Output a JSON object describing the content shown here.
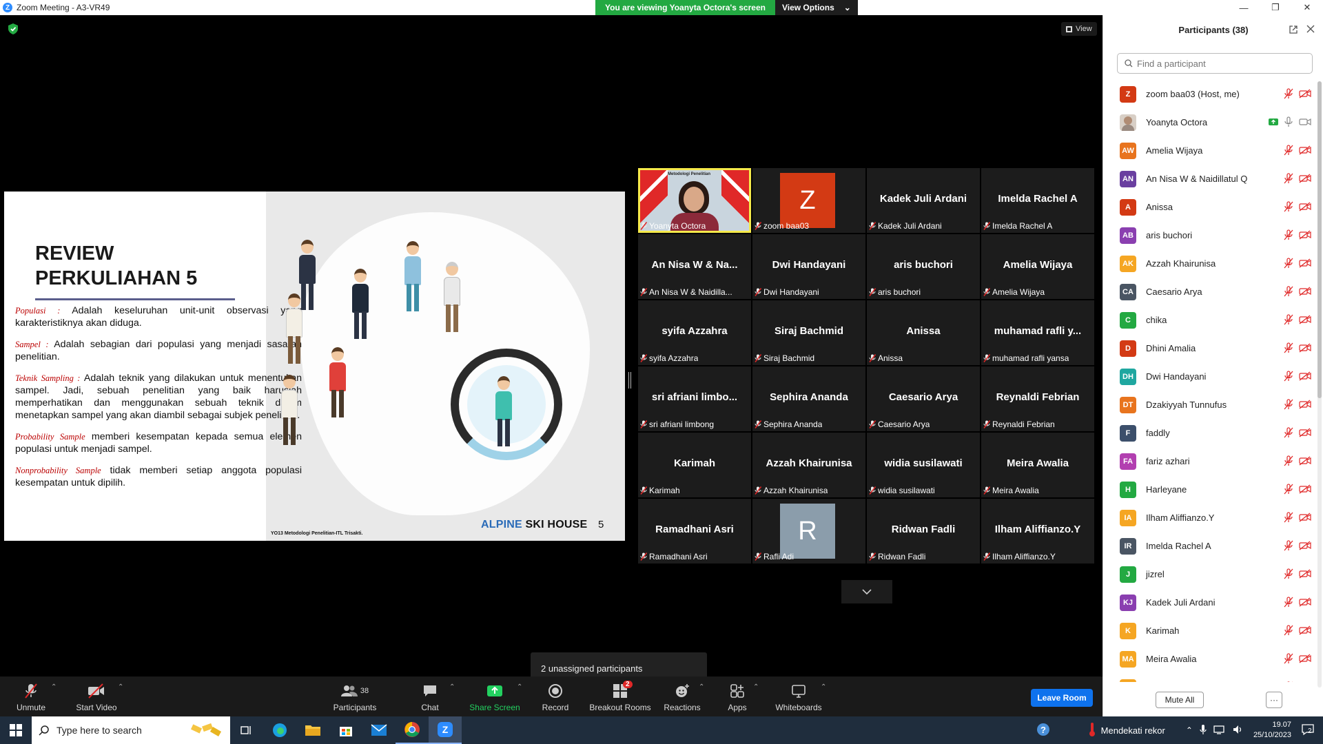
{
  "window": {
    "title": "Zoom Meeting - A3-VR49"
  },
  "share_banner": {
    "message": "You are viewing Yoanyta Octora's screen",
    "options_label": "View Options"
  },
  "view_label": "View",
  "slide": {
    "title_line1": "REVIEW",
    "title_line2": "PERKULIAHAN 5",
    "definitions": [
      {
        "term": "Populasi :",
        "text": " Adalah keseluruhan unit-unit observasi  yang karakteristiknya akan diduga."
      },
      {
        "term": "Sampel :",
        "text": " Adalah sebagian dari populasi yang menjadi sasaran penelitian."
      },
      {
        "term": "Teknik Sampling :",
        "text": "  Adalah teknik yang dilakukan untuk menentukan sampel. Jadi, sebuah penelitian yang baik haruslah memperhatikan dan menggunakan sebuah teknik dalam menetapkan sampel yang akan diambil sebagai subjek penelitian."
      },
      {
        "term": "Probability Sample",
        "text": " memberi kesempatan kepada semua elemen populasi untuk menjadi sampel."
      },
      {
        "term": "Nonprobability Sample",
        "text": " tidak memberi setiap anggota populasi kesempatan untuk dipilih."
      }
    ],
    "footer": "YO13 Metodologi Penelitian-ITL Trisakti.",
    "brand_alpine": "ALPINE",
    "brand_rest": " SKI HOUSE",
    "page_number": "5",
    "active_video_caption": "Metodologi Penelitian",
    "active_video_logo": "BAKRIE"
  },
  "video_tiles": [
    {
      "big": "",
      "label": "Yoanyta Octora",
      "type": "video"
    },
    {
      "big": "",
      "label": "zoom baa03",
      "type": "avatar",
      "initial": "Z",
      "color": "#d33a14"
    },
    {
      "big": "Kadek Juli Ardani",
      "label": "Kadek Juli Ardani"
    },
    {
      "big": "Imelda Rachel A",
      "label": "Imelda Rachel A"
    },
    {
      "big": "An Nisa W & Na...",
      "label": "An Nisa W & Naidilla..."
    },
    {
      "big": "Dwi Handayani",
      "label": "Dwi Handayani"
    },
    {
      "big": "aris buchori",
      "label": "aris buchori"
    },
    {
      "big": "Amelia Wijaya",
      "label": "Amelia Wijaya"
    },
    {
      "big": "syifa Azzahra",
      "label": "syifa Azzahra"
    },
    {
      "big": "Siraj Bachmid",
      "label": "Siraj Bachmid"
    },
    {
      "big": "Anissa",
      "label": "Anissa"
    },
    {
      "big": "muhamad rafli y...",
      "label": "muhamad rafli yansa"
    },
    {
      "big": "sri afriani limbo...",
      "label": "sri afriani limbong"
    },
    {
      "big": "Sephira Ananda",
      "label": "Sephira Ananda"
    },
    {
      "big": "Caesario Arya",
      "label": "Caesario Arya"
    },
    {
      "big": "Reynaldi Febrian",
      "label": "Reynaldi Febrian"
    },
    {
      "big": "Karimah",
      "label": "Karimah"
    },
    {
      "big": "Azzah Khairunisa",
      "label": "Azzah Khairunisa"
    },
    {
      "big": "widia susilawati",
      "label": "widia susilawati"
    },
    {
      "big": "Meira Awalia",
      "label": "Meira Awalia"
    },
    {
      "big": "Ramadhani Asri",
      "label": "Ramadhani Asri"
    },
    {
      "big": "",
      "label": "Rafli Adi",
      "type": "avatar",
      "initial": "R",
      "color": "#8b9dab"
    },
    {
      "big": "Ridwan Fadli",
      "label": "Ridwan Fadli"
    },
    {
      "big": "Ilham Aliffianzo.Y",
      "label": "Ilham Aliffianzo.Y"
    }
  ],
  "tooltip": "2 unassigned participants",
  "toolbar": {
    "unmute": "Unmute",
    "start_video": "Start Video",
    "participants": "Participants",
    "participants_count": "38",
    "chat": "Chat",
    "share_screen": "Share Screen",
    "record": "Record",
    "breakout_rooms": "Breakout Rooms",
    "breakout_badge": "2",
    "reactions": "Reactions",
    "apps": "Apps",
    "whiteboards": "Whiteboards",
    "leave": "Leave Room"
  },
  "panel": {
    "title": "Participants (38)",
    "search_placeholder": "Find a participant",
    "mute_all": "Mute All",
    "more": "···",
    "participants": [
      {
        "initials": "Z",
        "name": "zoom baa03 (Host, me)",
        "color": "#d33a14"
      },
      {
        "initials": "",
        "name": "Yoanyta Octora",
        "color": "#c9b8a8",
        "photo": true,
        "sharing": true
      },
      {
        "initials": "AW",
        "name": "Amelia Wijaya",
        "color": "#e8741e"
      },
      {
        "initials": "AN",
        "name": "An Nisa W & Naidillatul Q",
        "color": "#6a3fa0"
      },
      {
        "initials": "A",
        "name": "Anissa",
        "color": "#d33a14"
      },
      {
        "initials": "AB",
        "name": "aris buchori",
        "color": "#8a3fb0"
      },
      {
        "initials": "AK",
        "name": "Azzah Khairunisa",
        "color": "#f5a623"
      },
      {
        "initials": "CA",
        "name": "Caesario Arya",
        "color": "#4a5563"
      },
      {
        "initials": "C",
        "name": "chika",
        "color": "#23a942"
      },
      {
        "initials": "D",
        "name": "Dhini Amalia",
        "color": "#d33a14"
      },
      {
        "initials": "DH",
        "name": "Dwi Handayani",
        "color": "#1fa7a0"
      },
      {
        "initials": "DT",
        "name": "Dzakiyyah Tunnufus",
        "color": "#e8741e"
      },
      {
        "initials": "F",
        "name": "faddly",
        "color": "#3c4f6b"
      },
      {
        "initials": "FA",
        "name": "fariz azhari",
        "color": "#b23fb0"
      },
      {
        "initials": "H",
        "name": "Harleyane",
        "color": "#23a942"
      },
      {
        "initials": "IA",
        "name": "Ilham Aliffianzo.Y",
        "color": "#f5a623"
      },
      {
        "initials": "IR",
        "name": "Imelda Rachel A",
        "color": "#4a5563"
      },
      {
        "initials": "J",
        "name": "jizrel",
        "color": "#23a942"
      },
      {
        "initials": "KJ",
        "name": "Kadek Juli Ardani",
        "color": "#8a3fb0"
      },
      {
        "initials": "K",
        "name": "Karimah",
        "color": "#f5a623"
      },
      {
        "initials": "MA",
        "name": "Meira Awalia",
        "color": "#f5a623"
      },
      {
        "initials": "",
        "name": "",
        "color": "#f5a623"
      }
    ]
  },
  "taskbar": {
    "search_placeholder": "Type here to search",
    "weather_text": "Mendekati rekor",
    "time": "19.07",
    "date": "25/10/2023",
    "notification_count": "2"
  }
}
